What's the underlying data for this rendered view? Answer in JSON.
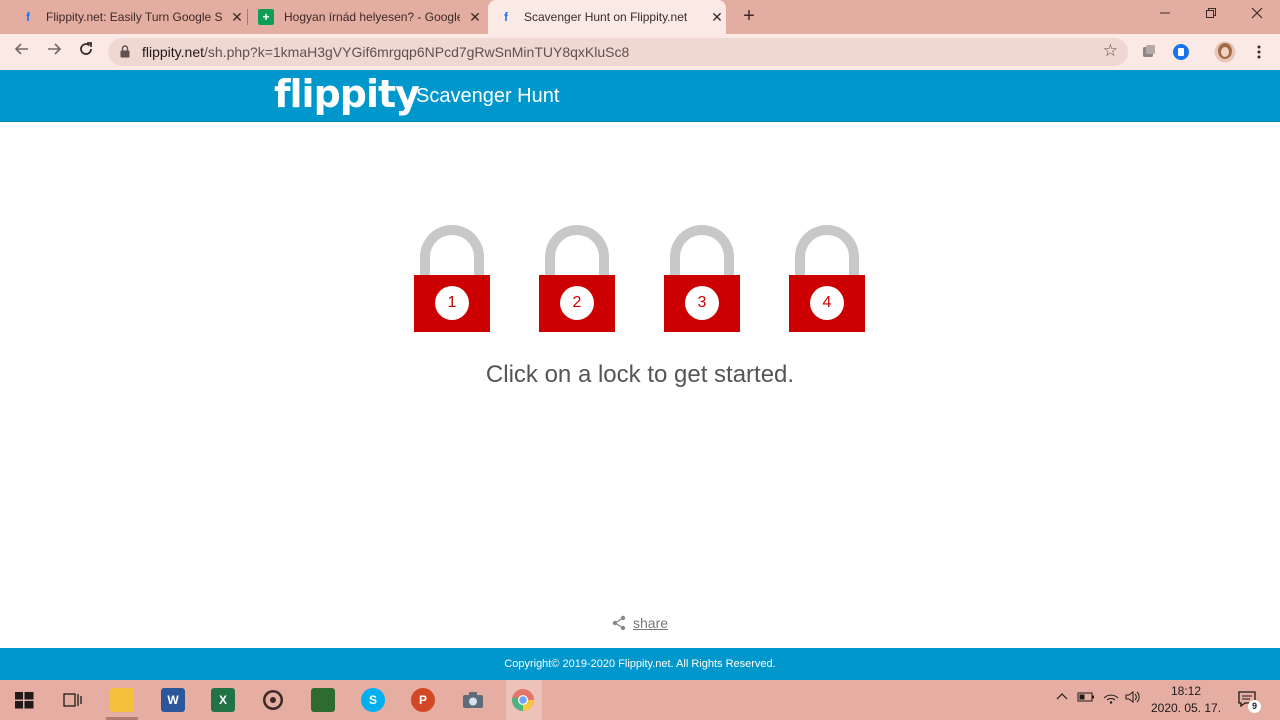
{
  "browser": {
    "tabs": [
      {
        "title": "Flippity.net: Easily Turn Google Sp",
        "icon": "facebook-f-icon"
      },
      {
        "title": "Hogyan írnád helyesen? - Google",
        "icon": "google-sheets-icon"
      },
      {
        "title": "Scavenger Hunt on Flippity.net",
        "icon": "facebook-f-icon"
      }
    ],
    "close_glyph": "✕",
    "new_tab_glyph": "+",
    "url_host": "flippity.net",
    "url_path": "/sh.php?k=1kmaH3gVYGif6mrgqp6NPcd7gRwSnMinTUY8qxKluSc8"
  },
  "site": {
    "logo": "flippity",
    "title": "Scavenger Hunt",
    "locks": [
      {
        "number": "1"
      },
      {
        "number": "2"
      },
      {
        "number": "3"
      },
      {
        "number": "4"
      }
    ],
    "instruction": "Click on a lock to get started.",
    "share_label": "share",
    "footer": "Copyright© 2019-2020 Flippity.net. All Rights Reserved.",
    "colors": {
      "header": "#0097cc",
      "lock": "#cc0000",
      "shackle": "#c8c8c8"
    }
  },
  "taskbar": {
    "apps": [
      {
        "name": "file-explorer-icon",
        "letter": ""
      },
      {
        "name": "word-icon",
        "letter": "W"
      },
      {
        "name": "excel-icon",
        "letter": "X"
      },
      {
        "name": "media-player-icon",
        "letter": ""
      },
      {
        "name": "chalkboard-app-icon",
        "letter": ""
      },
      {
        "name": "skype-icon",
        "letter": "S"
      },
      {
        "name": "powerpoint-icon",
        "letter": "P"
      },
      {
        "name": "camera-icon",
        "letter": ""
      },
      {
        "name": "chrome-icon",
        "letter": ""
      }
    ],
    "time": "18:12",
    "date": "2020. 05. 17.",
    "notification_count": "9"
  }
}
